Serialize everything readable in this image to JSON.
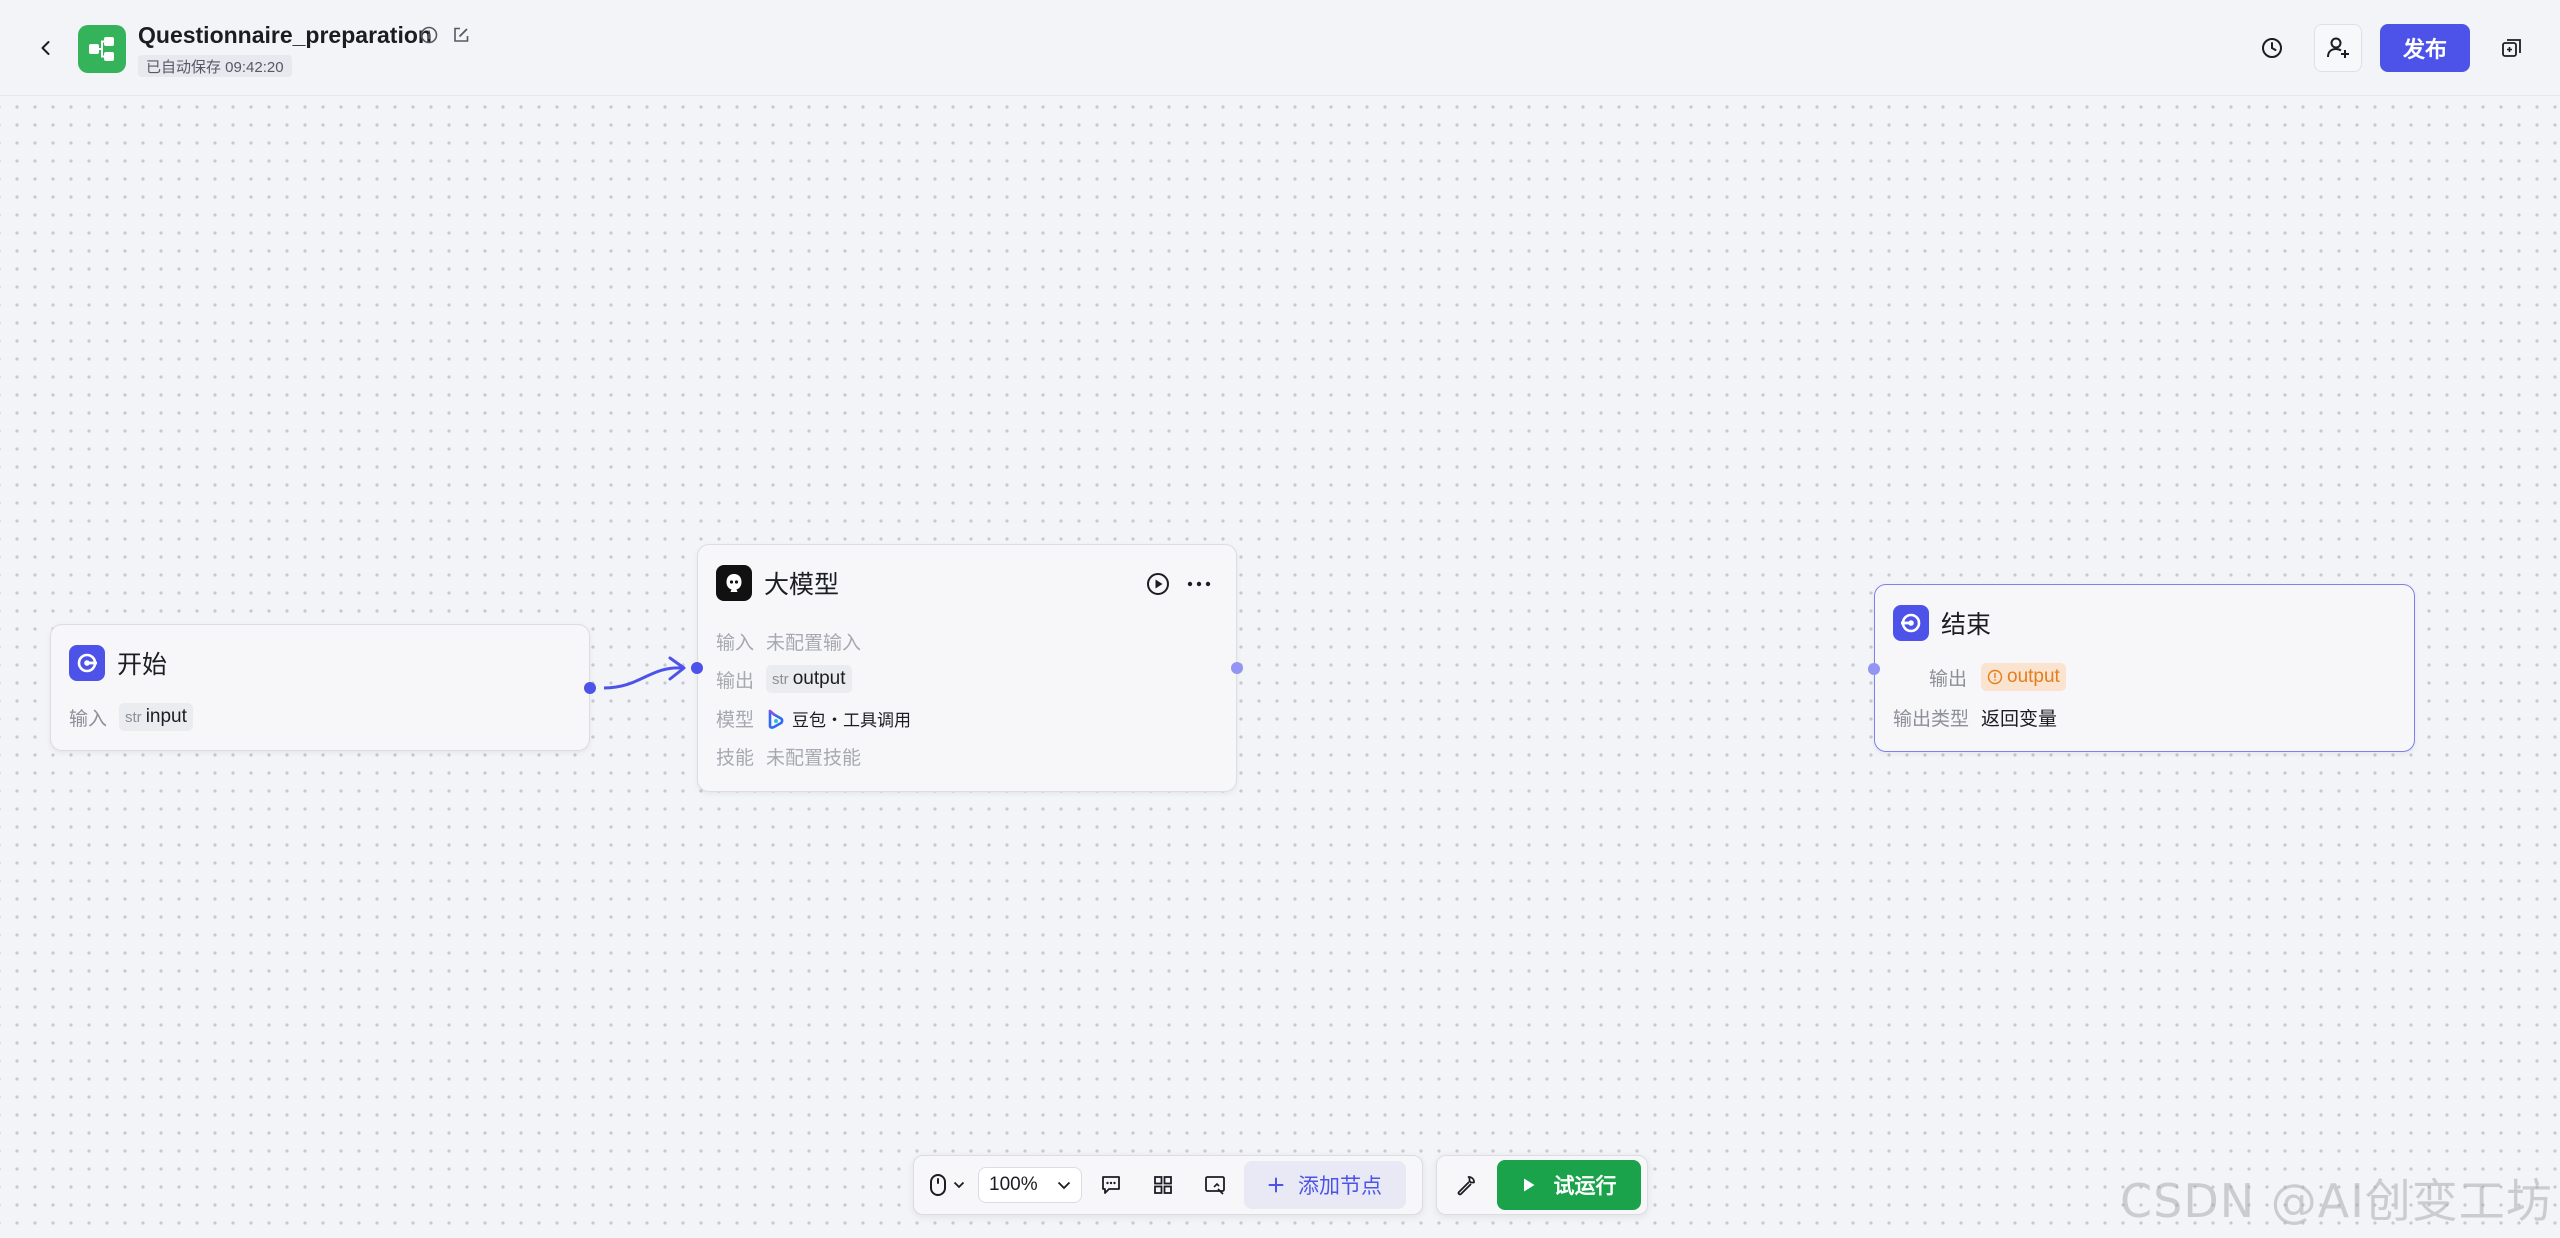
{
  "header": {
    "title": "Questionnaire_preparation",
    "autosave": "已自动保存 09:42:20",
    "publish_label": "发布"
  },
  "nodes": {
    "start": {
      "title": "开始",
      "input_label": "输入",
      "input_type": "str",
      "input_name": "input"
    },
    "llm": {
      "title": "大模型",
      "input_label": "输入",
      "input_value": "未配置输入",
      "output_label": "输出",
      "output_type": "str",
      "output_name": "output",
      "model_label": "模型",
      "model_value": "豆包・工具调用",
      "skill_label": "技能",
      "skill_value": "未配置技能"
    },
    "end": {
      "title": "结束",
      "output_label": "输出",
      "output_name": "output",
      "output_type_label": "输出类型",
      "output_type_value": "返回变量"
    }
  },
  "toolbar": {
    "zoom": "100%",
    "add_node_label": "添加节点",
    "run_label": "试运行"
  },
  "watermark": "CSDN @AI创变工坊",
  "colors": {
    "accent": "#4d53e8",
    "run_green": "#1aa34a",
    "app_icon_green": "#35b35a",
    "warning_orange": "#e37d1f"
  }
}
